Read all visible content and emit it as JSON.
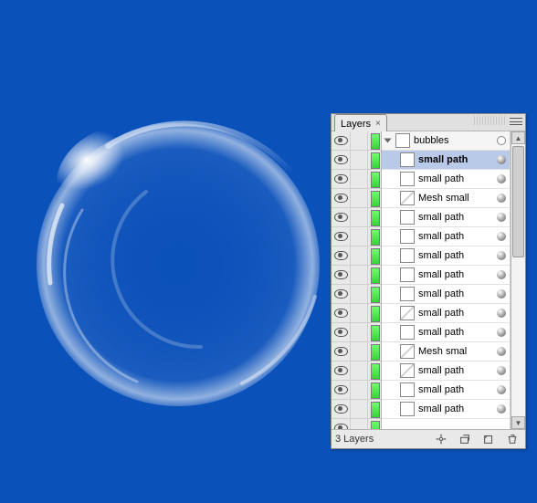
{
  "panel": {
    "tab_label": "Layers",
    "status_text": "3 Layers"
  },
  "layers": {
    "group": {
      "name": "bubbles"
    },
    "rows": [
      {
        "name": "small path",
        "selected": true,
        "thumb": "plain"
      },
      {
        "name": "small path",
        "selected": false,
        "thumb": "plain"
      },
      {
        "name": "Mesh small",
        "selected": false,
        "thumb": "mesh"
      },
      {
        "name": "small path",
        "selected": false,
        "thumb": "plain"
      },
      {
        "name": "small path",
        "selected": false,
        "thumb": "plain"
      },
      {
        "name": "small path",
        "selected": false,
        "thumb": "plain"
      },
      {
        "name": "small path",
        "selected": false,
        "thumb": "plain"
      },
      {
        "name": "small path",
        "selected": false,
        "thumb": "plain"
      },
      {
        "name": "small path",
        "selected": false,
        "thumb": "mesh"
      },
      {
        "name": "small path",
        "selected": false,
        "thumb": "plain"
      },
      {
        "name": "Mesh smal",
        "selected": false,
        "thumb": "mesh"
      },
      {
        "name": "small path",
        "selected": false,
        "thumb": "mesh"
      },
      {
        "name": "small path",
        "selected": false,
        "thumb": "plain"
      },
      {
        "name": "small path",
        "selected": false,
        "thumb": "plain"
      }
    ]
  }
}
